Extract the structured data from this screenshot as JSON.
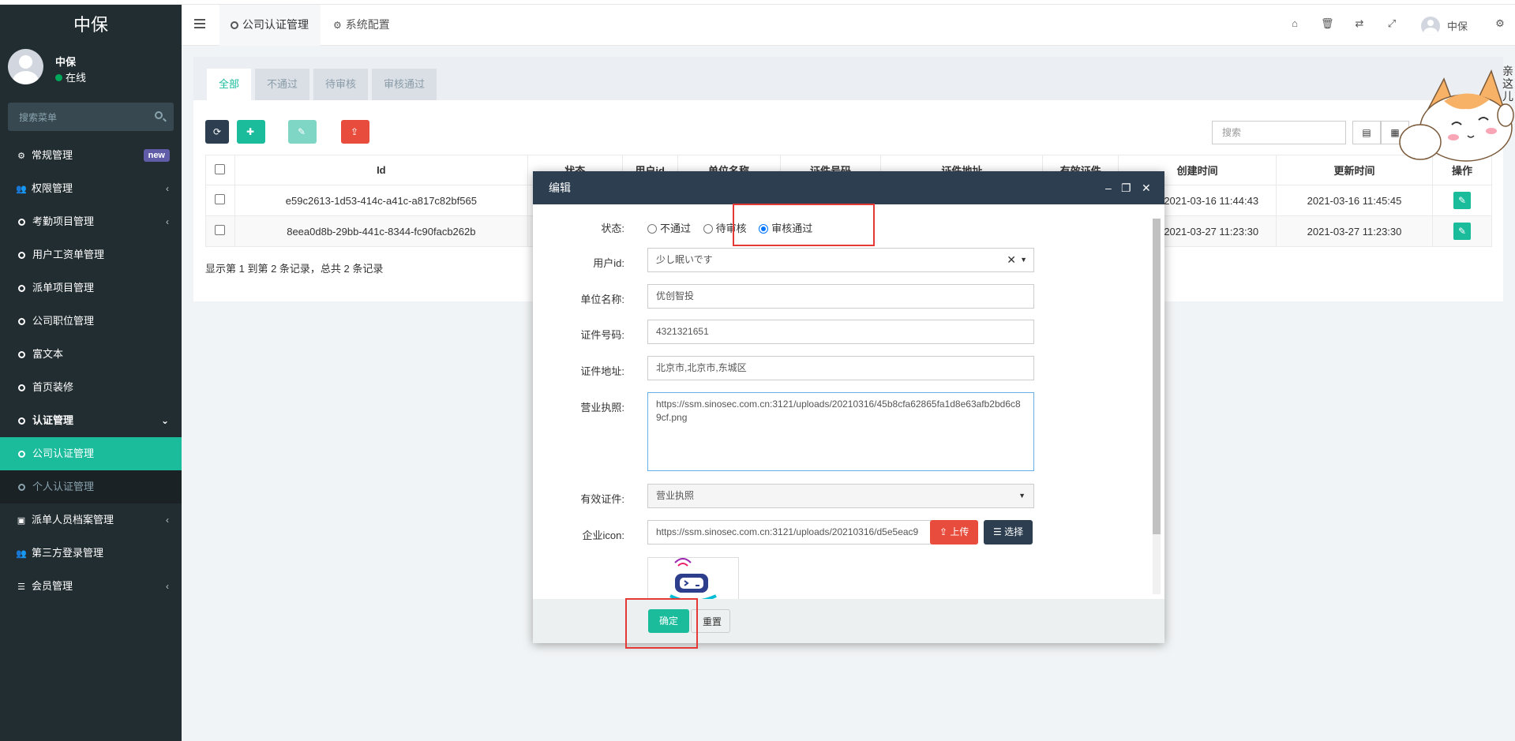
{
  "app": {
    "brand": "中保"
  },
  "user": {
    "name": "中保",
    "status": "在线"
  },
  "sidebar": {
    "search_placeholder": "搜索菜单",
    "items": [
      {
        "label": "常规管理",
        "badge": "new"
      },
      {
        "label": "权限管理"
      },
      {
        "label": "考勤项目管理"
      },
      {
        "label": "用户工资单管理"
      },
      {
        "label": "派单项目管理"
      },
      {
        "label": "公司职位管理"
      },
      {
        "label": "富文本"
      },
      {
        "label": "首页装修"
      },
      {
        "label": "认证管理"
      },
      {
        "label": "公司认证管理"
      },
      {
        "label": "个人认证管理"
      },
      {
        "label": "派单人员档案管理"
      },
      {
        "label": "第三方登录管理"
      },
      {
        "label": "会员管理"
      }
    ]
  },
  "header": {
    "tabs": [
      {
        "label": "公司认证管理"
      },
      {
        "label": "系统配置"
      }
    ],
    "user_name": "中保"
  },
  "filters": {
    "tabs": [
      "全部",
      "不通过",
      "待审核",
      "审核通过"
    ]
  },
  "toolbar": {
    "add": "添加",
    "edit": "编辑",
    "import": "导入",
    "search_placeholder": "搜索"
  },
  "table": {
    "headers": [
      "Id",
      "状态",
      "用户id",
      "单位名称",
      "证件号码",
      "证件地址",
      "有效证件",
      "创建时间",
      "更新时间",
      "操作"
    ],
    "rows": [
      {
        "id": "e59c2613-1d53-414c-a41c-a817c82bf565",
        "created": "2021-03-16 11:44:43",
        "updated": "2021-03-16 11:45:45"
      },
      {
        "id": "8eea0d8b-29bb-441c-8344-fc90facb262b",
        "created": "2021-03-27 11:23:30",
        "updated": "2021-03-27 11:23:30"
      }
    ],
    "pagination": "显示第 1 到第 2 条记录，总共 2 条记录"
  },
  "cat": {
    "text1": "亲",
    "text2": "这",
    "text3": "儿"
  },
  "modal": {
    "title": "编辑",
    "labels": {
      "status": "状态:",
      "user_id": "用户id:",
      "company": "单位名称:",
      "cert_no": "证件号码:",
      "cert_addr": "证件地址:",
      "license": "营业执照:",
      "valid_cert": "有效证件:",
      "icon": "企业icon:"
    },
    "status_options": [
      "不通过",
      "待审核",
      "审核通过"
    ],
    "values": {
      "user_id": "少し眠いです",
      "company": "优创智投",
      "cert_no": "4321321651",
      "cert_addr": "北京市,北京市,东城区",
      "license": "https://ssm.sinosec.com.cn:3121/uploads/20210316/45b8cfa62865fa1d8e63afb2bd6c89cf.png",
      "valid_cert": "营业执照",
      "icon": "https://ssm.sinosec.com.cn:3121/uploads/20210316/d5e5eac9"
    },
    "upload": "上传",
    "choose": "选择",
    "ok": "确定",
    "reset": "重置"
  }
}
